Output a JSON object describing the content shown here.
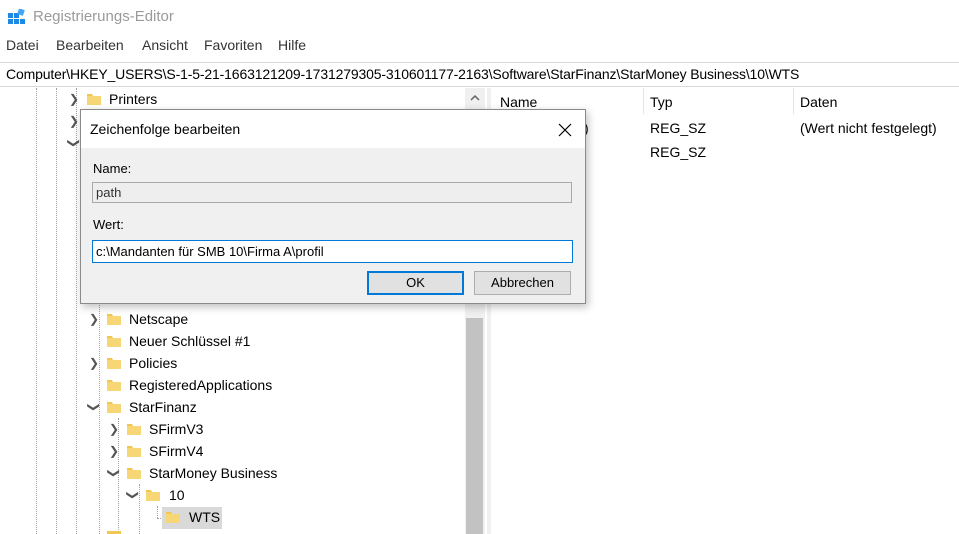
{
  "window": {
    "title": "Registrierungs-Editor",
    "app_icon": "regedit-icon"
  },
  "menu": [
    "Datei",
    "Bearbeiten",
    "Ansicht",
    "Favoriten",
    "Hilfe"
  ],
  "address": "Computer\\HKEY_USERS\\S-1-5-21-1663121209-1731279305-310601177-2163\\Software\\StarFinanz\\StarMoney Business\\10\\WTS",
  "tree": {
    "items": [
      {
        "label": "Printers",
        "expander": "collapsed"
      },
      {
        "label": "Netscape",
        "expander": "collapsed"
      },
      {
        "label": "Neuer Schlüssel #1",
        "expander": "none"
      },
      {
        "label": "Policies",
        "expander": "collapsed"
      },
      {
        "label": "RegisteredApplications",
        "expander": "none"
      },
      {
        "label": "StarFinanz",
        "expander": "expanded"
      },
      {
        "label": "SFirmV3",
        "expander": "collapsed"
      },
      {
        "label": "SFirmV4",
        "expander": "collapsed"
      },
      {
        "label": "StarMoney Business",
        "expander": "expanded"
      },
      {
        "label": "10",
        "expander": "expanded"
      },
      {
        "label": "WTS",
        "expander": "none",
        "selected": true
      }
    ]
  },
  "list": {
    "columns": [
      "Name",
      "Typ",
      "Daten"
    ],
    "rows": [
      {
        "name_fragment": ")",
        "type": "REG_SZ",
        "data": "(Wert nicht festgelegt)"
      },
      {
        "name_fragment": "",
        "type": "REG_SZ",
        "data": ""
      }
    ]
  },
  "dialog": {
    "title": "Zeichenfolge bearbeiten",
    "name_label": "Name:",
    "name_value": "path",
    "value_label": "Wert:",
    "value_value": "c:\\Mandanten für SMB 10\\Firma A\\profil",
    "ok_label": "OK",
    "cancel_label": "Abbrechen"
  },
  "colors": {
    "selection": "#d9d9d9",
    "accent": "#0078d7",
    "folder": "#f2c650"
  }
}
